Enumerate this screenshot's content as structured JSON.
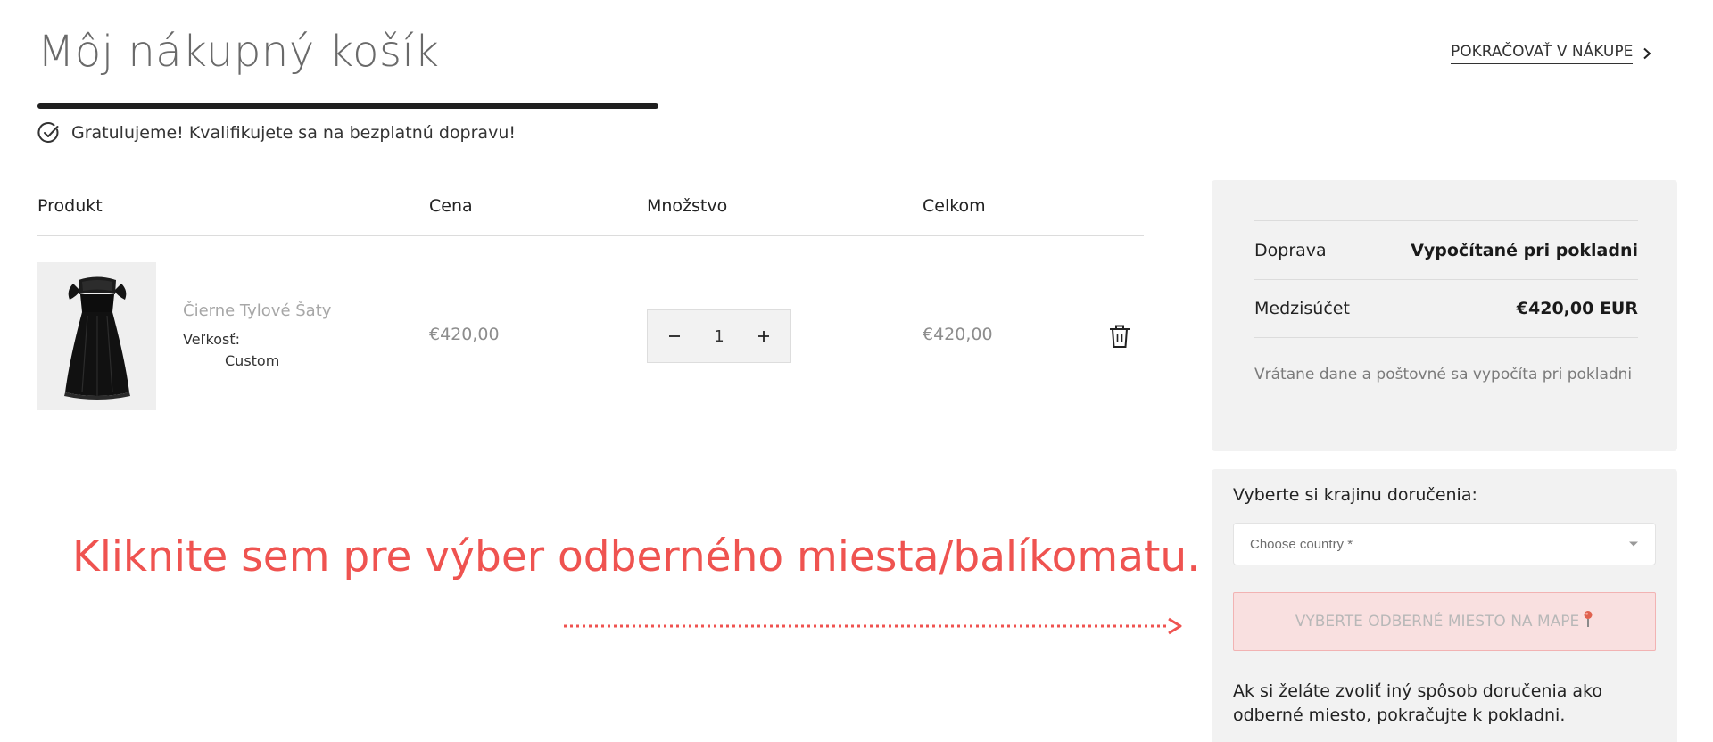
{
  "header": {
    "title": "Môj nákupný košík",
    "continue_label": "POKRAČOVAŤ V NÁKUPE"
  },
  "shipping_banner": {
    "message": "Gratulujeme! Kvalifikujete sa na bezplatnú dopravu!",
    "progress": 1.0
  },
  "cart_table": {
    "columns": [
      "Produkt",
      "Cena",
      "Množstvo",
      "Celkom"
    ],
    "items": [
      {
        "name": "Čierne Tylové Šaty",
        "variant_label": "Veľkosť:",
        "variant_value": "Custom",
        "price": "€420,00",
        "quantity": "1",
        "total": "€420,00"
      }
    ]
  },
  "summary": {
    "rows": [
      {
        "label": "Doprava",
        "value": "Vypočítané pri pokladni"
      },
      {
        "label": "Medzisúčet",
        "value": "€420,00 EUR"
      }
    ],
    "note": "Vrátane dane a poštovné sa vypočíta pri pokladni"
  },
  "delivery": {
    "label": "Vyberte si krajinu doručenia:",
    "country_placeholder": "Choose country *",
    "pickup_button_label": "VYBERTE ODBERNÉ MIESTO NA MAPE",
    "note": "Ak si želáte zvoliť iný spôsob doručenia ako odberné miesto, pokračujte k pokladni."
  },
  "callout": {
    "text": "Kliknite sem pre výber odberného miesta/balíkomatu."
  },
  "colors": {
    "accent": "#ef5350",
    "progress": "#1f1f1f",
    "panel": "#f2f2f2",
    "pickup_bg": "#f9e0e0"
  },
  "icons": [
    "chevron-right-icon",
    "check-circle-icon",
    "minus-icon",
    "plus-icon",
    "trash-icon",
    "chevron-down-icon",
    "map-pin-icon",
    "arrow-right-icon"
  ]
}
